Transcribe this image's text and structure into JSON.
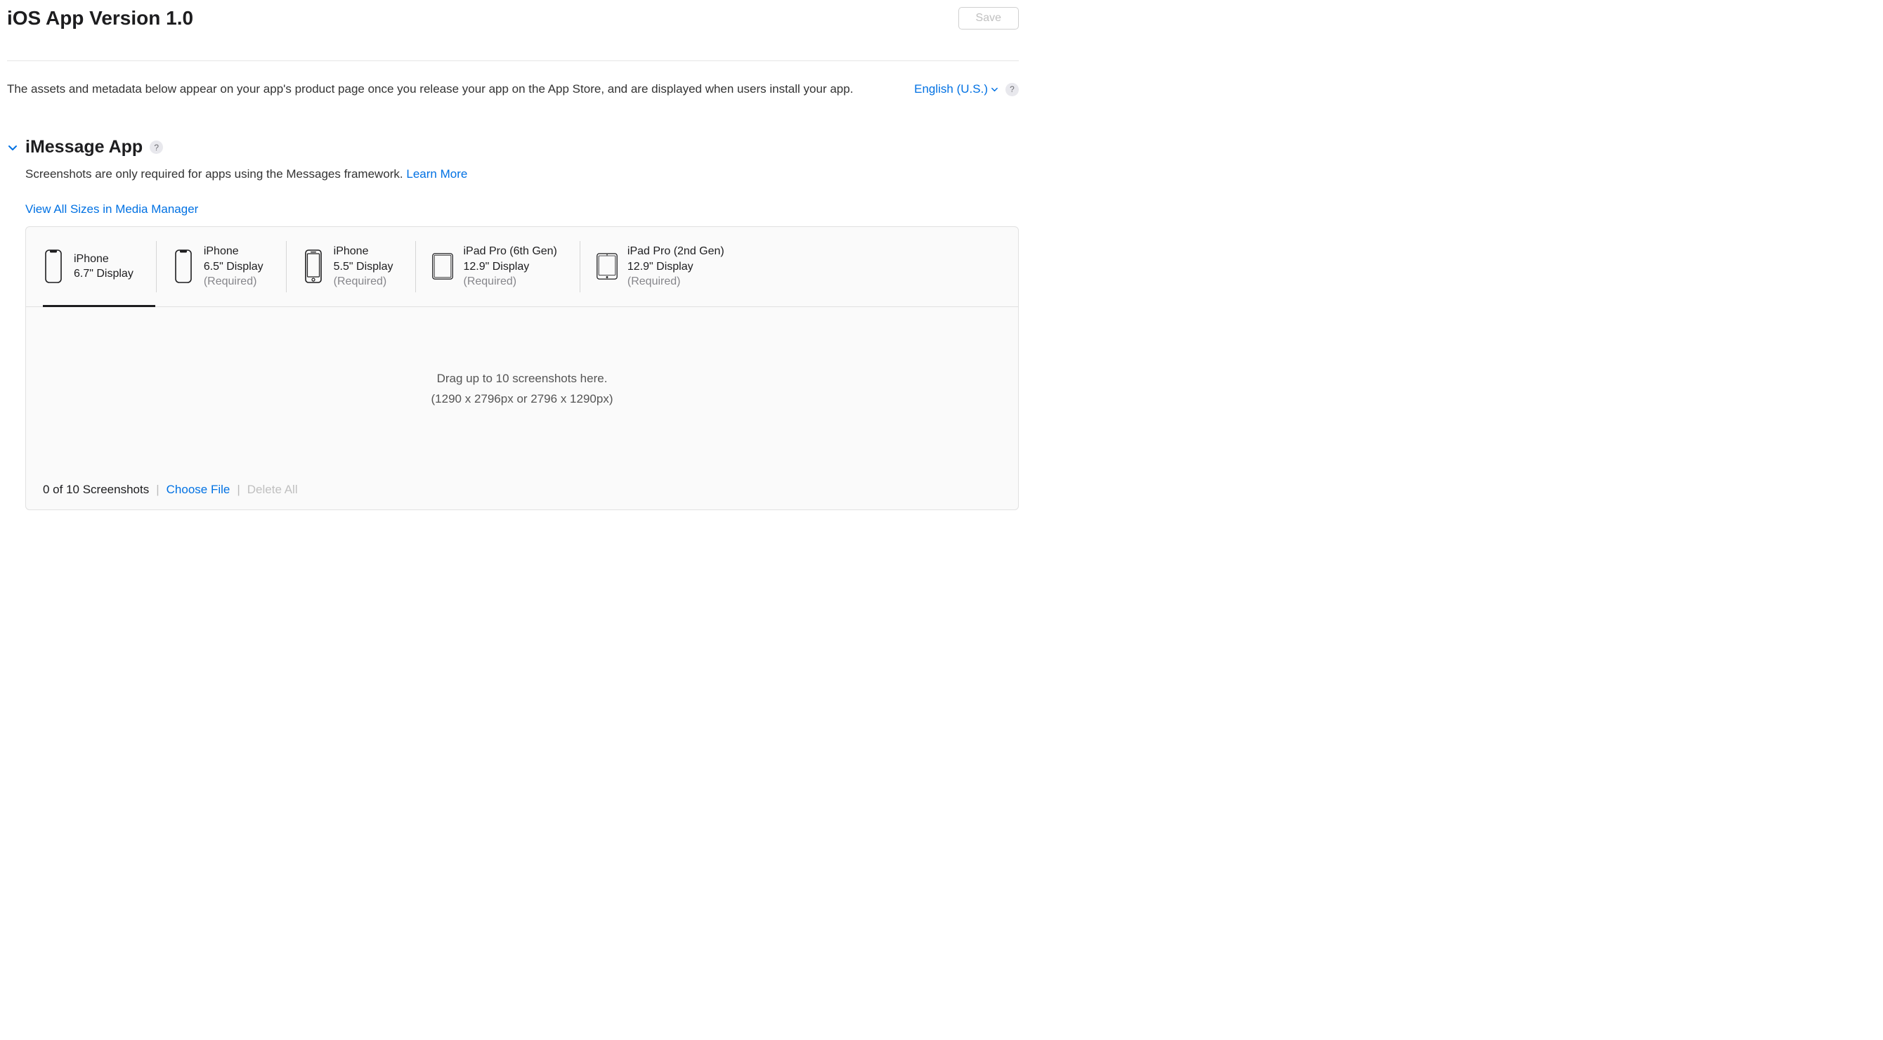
{
  "header": {
    "title": "iOS App Version 1.0",
    "save_label": "Save"
  },
  "info": {
    "text": "The assets and metadata below appear on your app's product page once you release your app on the App Store, and are displayed when users install your app.",
    "language": "English (U.S.)"
  },
  "section": {
    "title": "iMessage App",
    "subtitle": "Screenshots are only required for apps using the Messages framework. ",
    "learn_more": "Learn More",
    "view_all": "View All Sizes in Media Manager"
  },
  "devices": [
    {
      "name": "iPhone",
      "display": "6.7\" Display",
      "required": ""
    },
    {
      "name": "iPhone",
      "display": "6.5\" Display",
      "required": "(Required)"
    },
    {
      "name": "iPhone",
      "display": "5.5\" Display",
      "required": "(Required)"
    },
    {
      "name": "iPad Pro (6th Gen)",
      "display": "12.9\" Display",
      "required": "(Required)"
    },
    {
      "name": "iPad Pro (2nd Gen)",
      "display": "12.9\" Display",
      "required": "(Required)"
    }
  ],
  "dropzone": {
    "line1": "Drag up to 10 screenshots here.",
    "line2": "(1290 x 2796px or 2796 x 1290px)"
  },
  "footer": {
    "count_label": "0 of 10 Screenshots",
    "choose_file": "Choose File",
    "delete_all": "Delete All"
  }
}
